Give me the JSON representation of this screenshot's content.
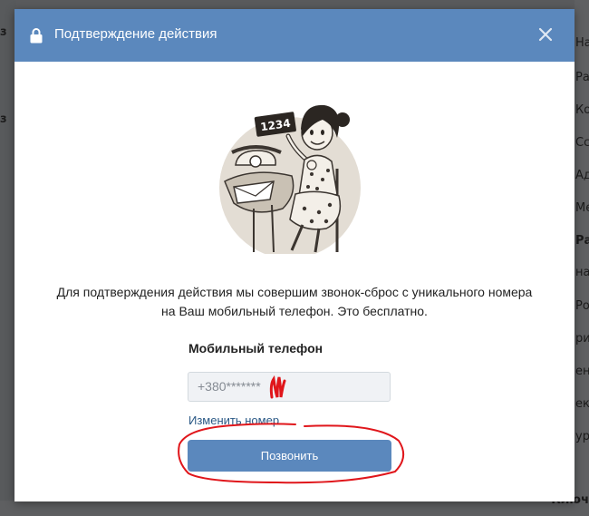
{
  "background": {
    "left_chars": [
      "з",
      "з"
    ],
    "right_items": [
      "Нас",
      "Ра",
      "Кон",
      "Сс",
      "Ад",
      "Ме",
      "Ра",
      "нас",
      "Ро",
      "ри",
      "ен",
      "екс",
      "ур"
    ],
    "bottom_text": "Ключ"
  },
  "modal": {
    "title": "Подтверждение действия",
    "illustration_number": "1234",
    "message_line1": "Для подтверждения действия мы совершим звонок-сброс с уникального номера",
    "message_line2": "на Ваш мобильный телефон. Это бесплатно.",
    "phone_label": "Мобильный телефон",
    "phone_value": "+380*******",
    "change_number_link": "Изменить номер",
    "call_button": "Позвонить"
  },
  "colors": {
    "header": "#5b88bd",
    "button": "#5b88bd",
    "link": "#2a5885",
    "annotation": "#e0161b"
  },
  "icons": [
    "lock-icon",
    "close-icon"
  ]
}
